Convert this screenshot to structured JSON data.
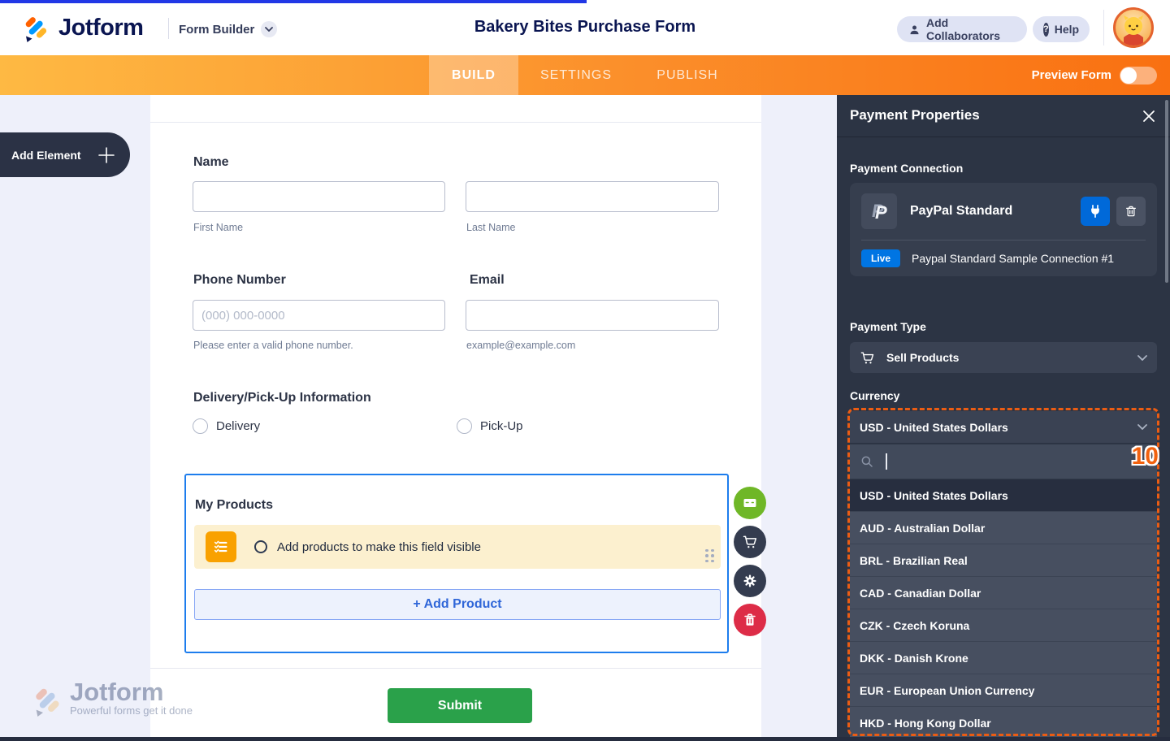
{
  "colors": {
    "brand_navy": "#0a1551",
    "nav_orange_left": "#feb943",
    "nav_orange_right": "#f97011",
    "panel_bg": "#2c3444",
    "selection_blue": "#1d7ded",
    "annotation_orange": "#eb5c13",
    "live_badge_blue": "#0075e3",
    "submit_green": "#2aa14a",
    "notice_yellow": "#fcf0cf",
    "notice_icon_orange": "#f9a100"
  },
  "header": {
    "logo_text": "Jotform",
    "product": "Form Builder",
    "form_title": "Bakery Bites Purchase Form",
    "add_collaborators": "Add Collaborators",
    "help": "Help"
  },
  "nav": {
    "tabs": [
      {
        "label": "BUILD",
        "active": true
      },
      {
        "label": "SETTINGS",
        "active": false
      },
      {
        "label": "PUBLISH",
        "active": false
      }
    ],
    "preview_form": "Preview Form"
  },
  "sidebar": {
    "add_element": "Add Element"
  },
  "form": {
    "name": {
      "label": "Name",
      "first_sublabel": "First Name",
      "last_sublabel": "Last Name"
    },
    "phone": {
      "label": "Phone Number",
      "placeholder": "(000) 000-0000",
      "sublabel": "Please enter a valid phone number."
    },
    "email": {
      "label": "Email",
      "sublabel": "example@example.com"
    },
    "delivery": {
      "label": "Delivery/Pick-Up Information",
      "options": [
        "Delivery",
        "Pick-Up"
      ]
    },
    "products": {
      "label": "My Products",
      "notice": "Add products to make this field visible",
      "add_button": "+ Add Product"
    },
    "submit": "Submit"
  },
  "watermark": {
    "logo_text": "Jotform",
    "tagline": "Powerful forms get it done"
  },
  "panel": {
    "title": "Payment Properties",
    "connection": {
      "section_label": "Payment Connection",
      "name": "PayPal Standard",
      "status": "Live",
      "connection_name": "Paypal Standard Sample Connection #1"
    },
    "payment_type": {
      "label": "Payment Type",
      "value": "Sell Products"
    },
    "currency": {
      "label": "Currency",
      "selected": "USD - United States Dollars",
      "search_value": "",
      "options": [
        "USD - United States Dollars",
        "AUD - Australian Dollar",
        "BRL - Brazilian Real",
        "CAD - Canadian Dollar",
        "CZK - Czech Koruna",
        "DKK - Danish Krone",
        "EUR - European Union Currency",
        "HKD - Hong Kong Dollar"
      ]
    },
    "annotation_badge": "10"
  }
}
